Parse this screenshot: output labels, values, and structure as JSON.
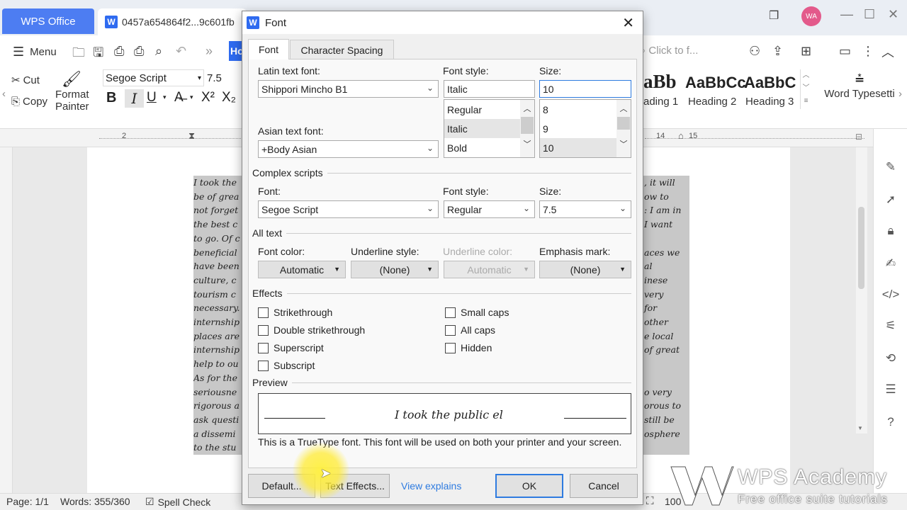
{
  "app": {
    "app_tab": "WPS Office",
    "doc_tab": "0457a654864f2...9c601fb",
    "avatar": "WA"
  },
  "menubar": {
    "menu_label": "Menu",
    "home_tab": "Ho",
    "search_placeholder": "Click to f..."
  },
  "ribbon": {
    "cut": "Cut",
    "copy": "Copy",
    "format_painter_1": "Format",
    "format_painter_2": "Painter",
    "font_name": "Segoe Script",
    "font_size": "7.5",
    "styles": [
      {
        "sample": "aBb",
        "label": "ading 1"
      },
      {
        "sample": "AaBbCc",
        "label": "Heading 2"
      },
      {
        "sample": "AaBbC",
        "label": "Heading 3"
      }
    ],
    "word_typesetting": "Word Typesetti"
  },
  "document": {
    "left_lines": [
      "I took the",
      "be of grea",
      "not forget",
      "the best c",
      "to go. Of c",
      "beneficial",
      "have been",
      "culture, c",
      "tourism c",
      "necessary.",
      "internship",
      "places are",
      "internship",
      "help to ou",
      "As for the",
      "seriousne",
      "rigorous a",
      "ask questi",
      "a dissemi",
      "to the stu"
    ],
    "right_lines": [
      ", it will",
      "ow to",
      ": I am in",
      "I want",
      "",
      "aces we",
      "al",
      "inese",
      "very",
      "for",
      "other",
      "e local",
      "of great",
      "",
      "",
      "o very",
      "orous to",
      "still be",
      "osphere",
      ""
    ]
  },
  "dialog": {
    "title": "Font",
    "tabs": [
      "Font",
      "Character Spacing"
    ],
    "latin_font_label": "Latin text font:",
    "latin_font_value": "Shippori Mincho B1",
    "font_style_label": "Font style:",
    "font_style_value": "Italic",
    "font_style_options": [
      "Regular",
      "Italic",
      "Bold"
    ],
    "size_label": "Size:",
    "size_value": "10",
    "size_options": [
      "8",
      "9",
      "10"
    ],
    "asian_font_label": "Asian text font:",
    "asian_font_value": "+Body Asian",
    "complex_section": "Complex scripts",
    "complex_font_label": "Font:",
    "complex_font_value": "Segoe Script",
    "complex_style_label": "Font style:",
    "complex_style_value": "Regular",
    "complex_size_label": "Size:",
    "complex_size_value": "7.5",
    "all_text_section": "All text",
    "font_color_label": "Font color:",
    "font_color_value": "Automatic",
    "underline_style_label": "Underline style:",
    "underline_style_value": "(None)",
    "underline_color_label": "Underline color:",
    "underline_color_value": "Automatic",
    "emphasis_label": "Emphasis mark:",
    "emphasis_value": "(None)",
    "effects_section": "Effects",
    "effects_left": [
      "Strikethrough",
      "Double strikethrough",
      "Superscript",
      "Subscript"
    ],
    "effects_right": [
      "Small caps",
      "All caps",
      "Hidden"
    ],
    "preview_section": "Preview",
    "preview_text": "I took the public el",
    "truetype_note": "This is a TrueType font. This font will be used on both your printer and your screen.",
    "btn_default": "Default...",
    "btn_text_effects": "Text Effects...",
    "link_view_explains": "View explains",
    "btn_ok": "OK",
    "btn_cancel": "Cancel"
  },
  "status": {
    "page": "Page: 1/1",
    "words": "Words: 355/360",
    "spell_check": "Spell Check",
    "zoom": "100"
  },
  "watermark": {
    "brand": "WPS Academy",
    "tagline": "Free office suite tutorials"
  },
  "colors": {
    "accent": "#2e7be0",
    "app_tab_blue": "#4d7df2",
    "highlight": "#c8c8c8",
    "avatar_pink": "#e35a8b"
  }
}
